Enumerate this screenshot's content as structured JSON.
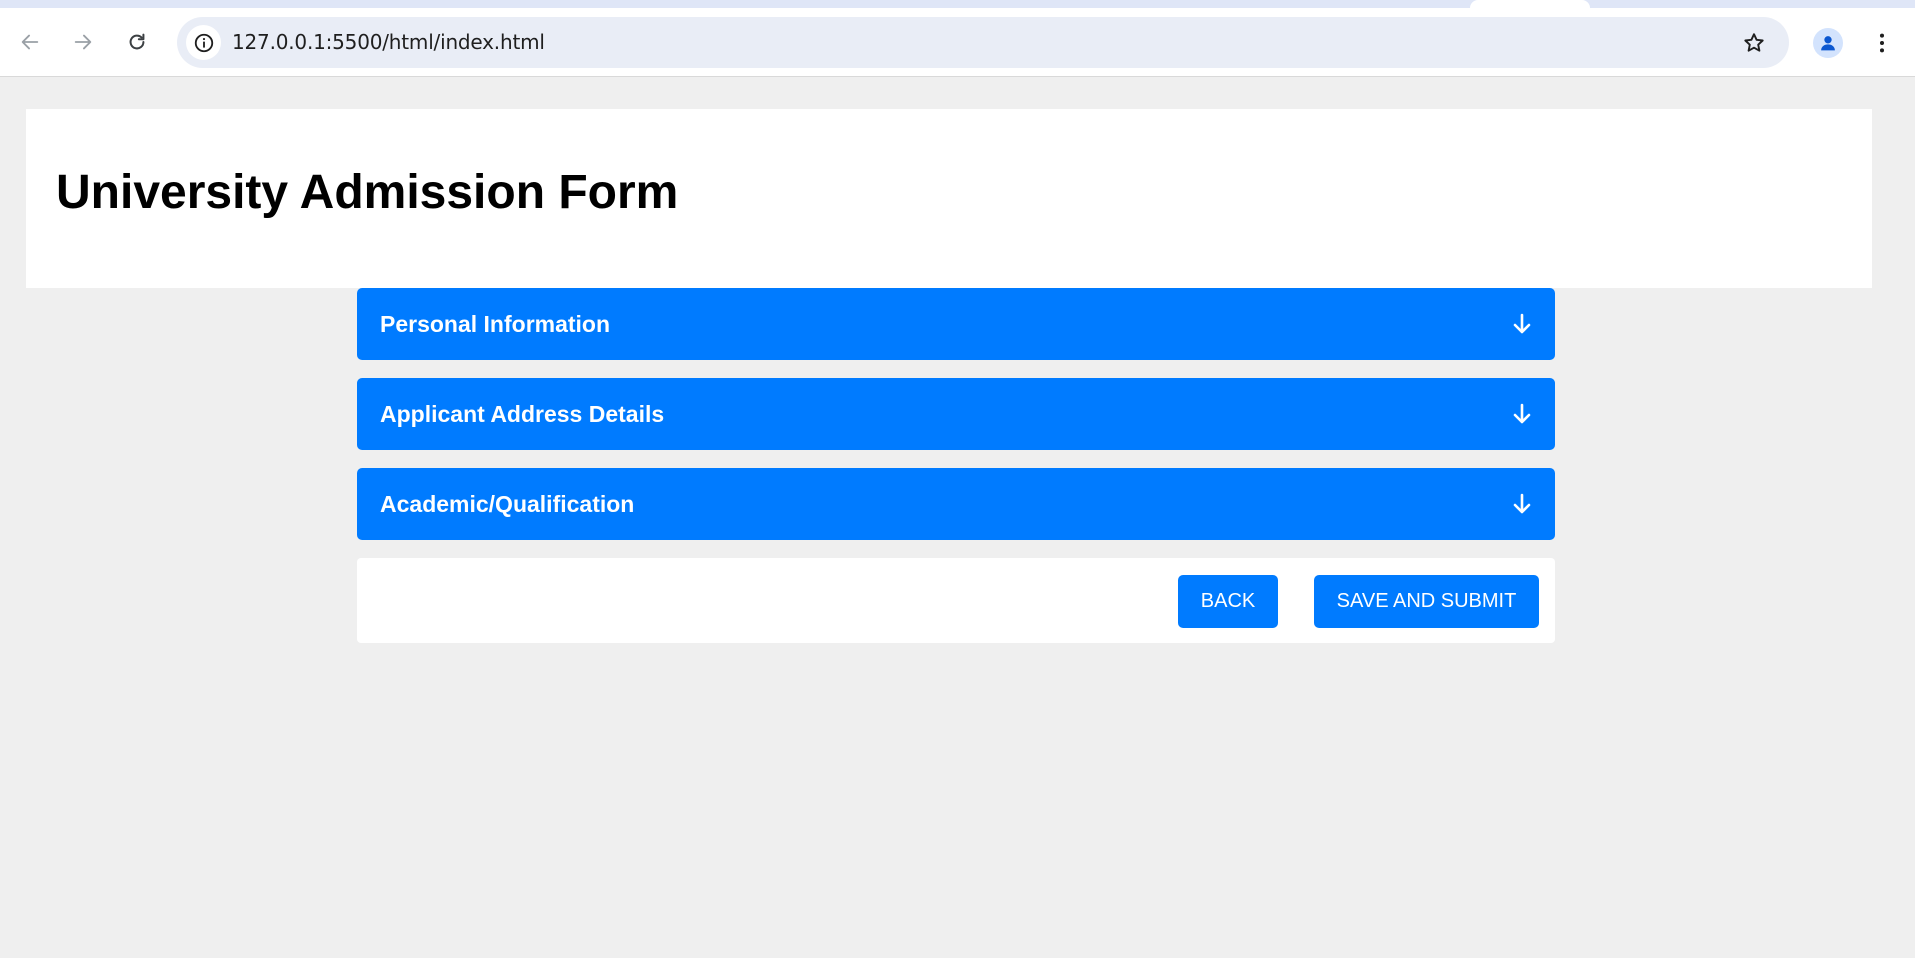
{
  "browser": {
    "url": "127.0.0.1:5500/html/index.html",
    "icons": {
      "back": "arrow-left-icon",
      "forward": "arrow-right-icon",
      "reload": "reload-icon",
      "site_info": "info-icon",
      "bookmark": "star-icon",
      "profile": "person-icon",
      "menu": "more-vertical-icon"
    }
  },
  "page": {
    "title": "University Admission Form",
    "sections": [
      {
        "label": "Personal Information",
        "icon": "arrow-down-icon"
      },
      {
        "label": "Applicant Address Details",
        "icon": "arrow-down-icon"
      },
      {
        "label": "Academic/Qualification",
        "icon": "arrow-down-icon"
      }
    ],
    "actions": {
      "back_label": "BACK",
      "submit_label": "SAVE AND SUBMIT"
    }
  },
  "colors": {
    "accent": "#007bff",
    "page_background": "#efefef",
    "panel_background": "#ffffff",
    "omnibox_background": "#e9edf6"
  }
}
